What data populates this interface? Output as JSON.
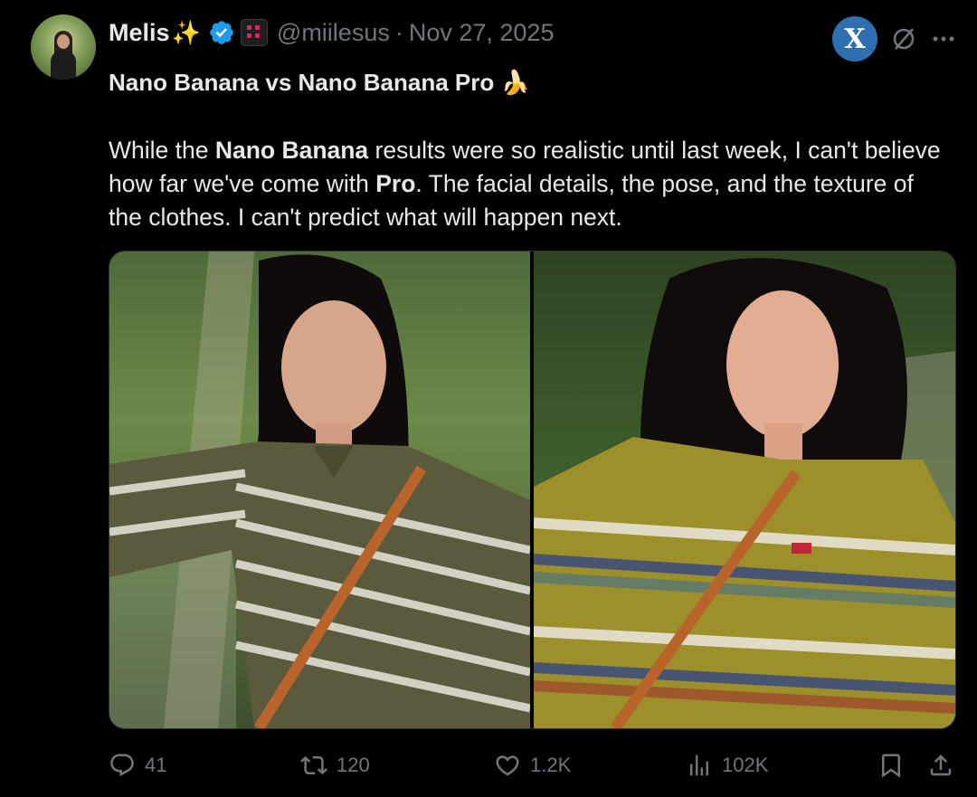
{
  "author": {
    "name": "Melis",
    "name_emoji": "✨",
    "handle": "@miilesus",
    "separator": "·",
    "date": "Nov 27, 2025"
  },
  "top_actions": {
    "grok_label": "X"
  },
  "post": {
    "title": "Nano Banana vs Nano Banana Pro",
    "title_emoji": "🍌",
    "body_1": "While the ",
    "body_bold_1": "Nano Banana",
    "body_2": " results were so realistic until last week, I can't believe how far we've come with ",
    "body_bold_2": "Pro",
    "body_3": ". The facial details, the pose, and the texture of the clothes. I can't predict what will happen next."
  },
  "metrics": {
    "replies": "41",
    "reposts": "120",
    "likes": "1.2K",
    "views": "102K"
  },
  "colors": {
    "background": "#000000",
    "text": "#e7e9ea",
    "muted": "#71767b",
    "verified": "#1d9bf0",
    "grok": "#2f6fb0"
  }
}
